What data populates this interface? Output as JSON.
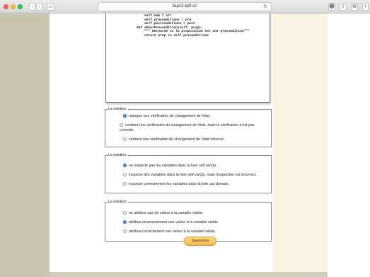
{
  "browser": {
    "url": "ilapc3.epfl.ch",
    "back_glyph": "‹",
    "forward_glyph": "›",
    "sidebar_glyph": "▭",
    "reload_glyph": "↻",
    "download_glyph": "⓿",
    "share_glyph": "⇧",
    "tabs_glyph": "⧉",
    "plus_glyph": "+"
  },
  "code": {
    "lines": [
      "        self.nom = str",
      "        self.preconditions = pre",
      "        self.postconditions = post",
      "",
      "    def aPourPrecondition(self, prop):",
      "        \"\"\" Retourne si la proposition est une precondition\"\"\"",
      "        return prop in self.preconditions"
    ]
  },
  "solutions": [
    {
      "legend": "La solution:",
      "options": [
        {
          "label": "manque une vérification du changement de l'état.",
          "checked": true
        },
        {
          "label": "contient une vérification du changement de l'état, mais la vérification n'est pas correcte.",
          "checked": false
        },
        {
          "label": "contient une vérification du changement de l'état correcte.",
          "checked": false
        }
      ]
    },
    {
      "legend": "La solution:",
      "options": [
        {
          "pre": "ne inspecte pas les variables dans la liste ",
          "em": "self.varOp",
          "post": ".",
          "checked": true
        },
        {
          "pre": "inspecte des variables dans la liste ",
          "em": "self.varOp",
          "post": ", mais l'inspection est incorrect.",
          "checked": false
        },
        {
          "pre": "inspecte correctement les variables dans la liste ",
          "em": "var.domain",
          "post": ".",
          "checked": false
        }
      ]
    },
    {
      "legend": "La solution:",
      "options": [
        {
          "pre": "ne attribue pas de valeur à la variable valide.",
          "em": "",
          "post": "",
          "checked": false
        },
        {
          "pre": "attribue ",
          "em": "incorrectement",
          "post": " une valeur à la variable valide.",
          "checked": true
        },
        {
          "pre": "attribue ",
          "em": "correctement",
          "post": " une valeur à la variable valide.",
          "checked": false
        }
      ]
    }
  ],
  "submit_label": "Soumettre",
  "colors": {
    "left_sidebar": "#cbc6b1",
    "right_sidebar": "#f8f3e3",
    "radio_checked": "#3b82d8",
    "submit": "#f6b94a"
  }
}
